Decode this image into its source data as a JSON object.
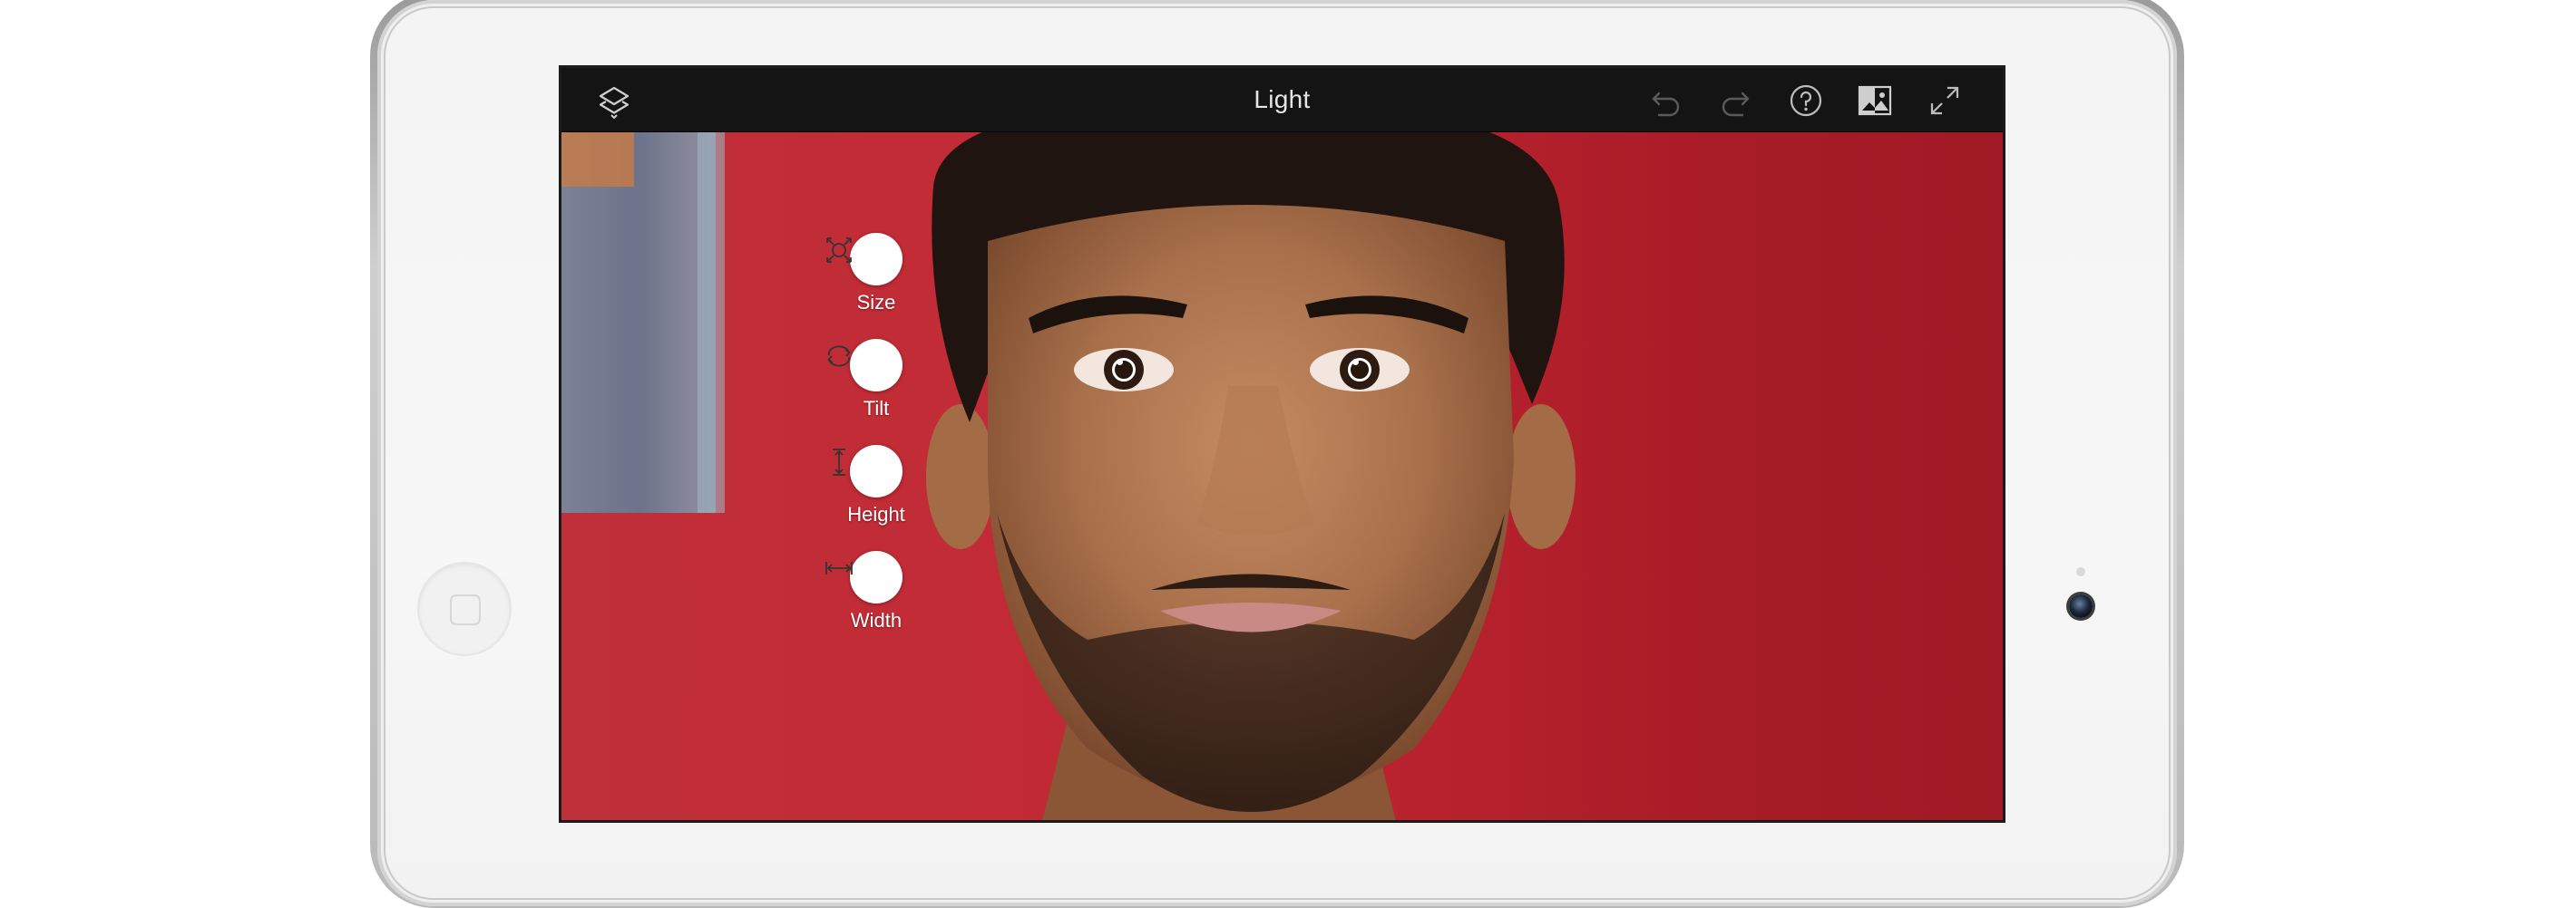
{
  "app": {
    "title": "Light"
  },
  "toolbar": {
    "left_icon": "layers-icon",
    "right_icons": [
      "undo-icon",
      "redo-icon",
      "help-icon",
      "image-compare-icon",
      "fullscreen-icon"
    ]
  },
  "tools": [
    {
      "label": "Size",
      "icon": "size-icon"
    },
    {
      "label": "Tilt",
      "icon": "tilt-icon"
    },
    {
      "label": "Height",
      "icon": "height-icon"
    },
    {
      "label": "Width",
      "icon": "width-icon"
    }
  ],
  "colors": {
    "toolbar_bg": "#141414",
    "backdrop_red": "#b8222d",
    "title_text": "#e6e6e6",
    "icon_disabled": "#5a5a5a",
    "icon_active": "#cfcfcf"
  }
}
